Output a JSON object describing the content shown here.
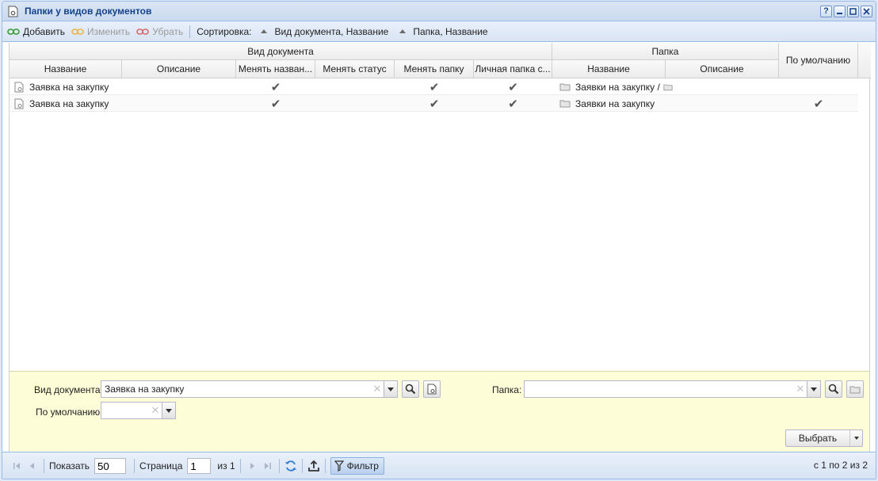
{
  "window": {
    "title": "Папки у видов документов"
  },
  "toolbar": {
    "add": "Добавить",
    "edit": "Изменить",
    "remove": "Убрать",
    "sort_label": "Сортировка:",
    "sort1": "Вид документа, Название",
    "sort2": "Папка, Название"
  },
  "grid": {
    "group_doc": "Вид документа",
    "group_folder": "Папка",
    "col_name": "Название",
    "col_desc": "Описание",
    "col_rename": "Менять назван...",
    "col_status": "Менять статус",
    "col_move": "Менять папку",
    "col_personal": "Личная папка с...",
    "col_folder_name": "Название",
    "col_folder_desc": "Описание",
    "col_default": "По умолчанию",
    "check_mark": "✔",
    "rows": [
      {
        "name": "Заявка на закупку",
        "rename": true,
        "status": false,
        "move": true,
        "personal": true,
        "folder": "Заявки на закупку /",
        "default": false
      },
      {
        "name": "Заявка на закупку",
        "rename": true,
        "status": false,
        "move": true,
        "personal": true,
        "folder": "Заявки на закупку",
        "default": true
      }
    ]
  },
  "filter": {
    "doc_type_label": "Вид документа:",
    "doc_type_value": "Заявка на закупку",
    "folder_label": "Папка:",
    "folder_value": "",
    "default_label": "По умолчанию:",
    "default_value": "",
    "select_button": "Выбрать"
  },
  "pager": {
    "show_label": "Показать",
    "page_size": "50",
    "page_label": "Страница",
    "page_value": "1",
    "of_label": "из 1",
    "filter_button": "Фильтр",
    "info": "с 1 по 2 из 2"
  }
}
